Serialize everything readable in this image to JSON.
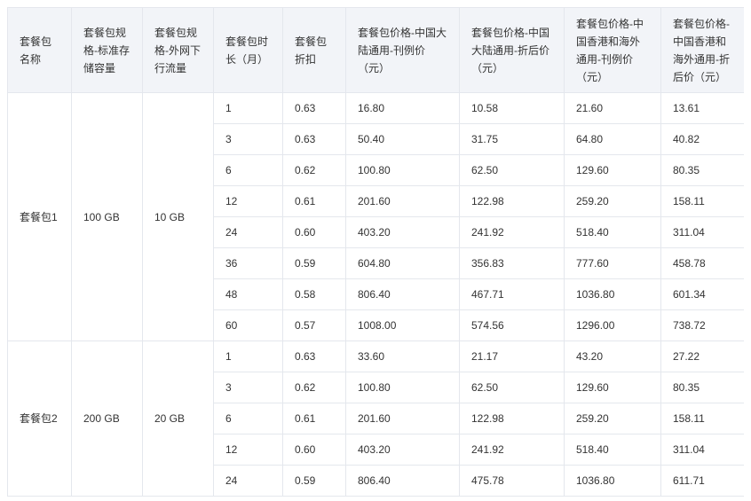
{
  "headers": [
    "套餐包名称",
    "套餐包规格-标准存储容量",
    "套餐包规格-外网下行流量",
    "套餐包时长（月）",
    "套餐包折扣",
    "套餐包价格-中国大陆通用-刊例价（元）",
    "套餐包价格-中国大陆通用-折后价（元）",
    "套餐包价格-中国香港和海外通用-刊例价（元）",
    "套餐包价格-中国香港和海外通用-折后价（元）"
  ],
  "groups": [
    {
      "name": "套餐包1",
      "storage": "100 GB",
      "traffic": "10 GB",
      "rows": [
        [
          "1",
          "0.63",
          "16.80",
          "10.58",
          "21.60",
          "13.61"
        ],
        [
          "3",
          "0.63",
          "50.40",
          "31.75",
          "64.80",
          "40.82"
        ],
        [
          "6",
          "0.62",
          "100.80",
          "62.50",
          "129.60",
          "80.35"
        ],
        [
          "12",
          "0.61",
          "201.60",
          "122.98",
          "259.20",
          "158.11"
        ],
        [
          "24",
          "0.60",
          "403.20",
          "241.92",
          "518.40",
          "311.04"
        ],
        [
          "36",
          "0.59",
          "604.80",
          "356.83",
          "777.60",
          "458.78"
        ],
        [
          "48",
          "0.58",
          "806.40",
          "467.71",
          "1036.80",
          "601.34"
        ],
        [
          "60",
          "0.57",
          "1008.00",
          "574.56",
          "1296.00",
          "738.72"
        ]
      ]
    },
    {
      "name": "套餐包2",
      "storage": "200 GB",
      "traffic": "20 GB",
      "rows": [
        [
          "1",
          "0.63",
          "33.60",
          "21.17",
          "43.20",
          "27.22"
        ],
        [
          "3",
          "0.62",
          "100.80",
          "62.50",
          "129.60",
          "80.35"
        ],
        [
          "6",
          "0.61",
          "201.60",
          "122.98",
          "259.20",
          "158.11"
        ],
        [
          "12",
          "0.60",
          "403.20",
          "241.92",
          "518.40",
          "311.04"
        ],
        [
          "24",
          "0.59",
          "806.40",
          "475.78",
          "1036.80",
          "611.71"
        ]
      ]
    }
  ]
}
